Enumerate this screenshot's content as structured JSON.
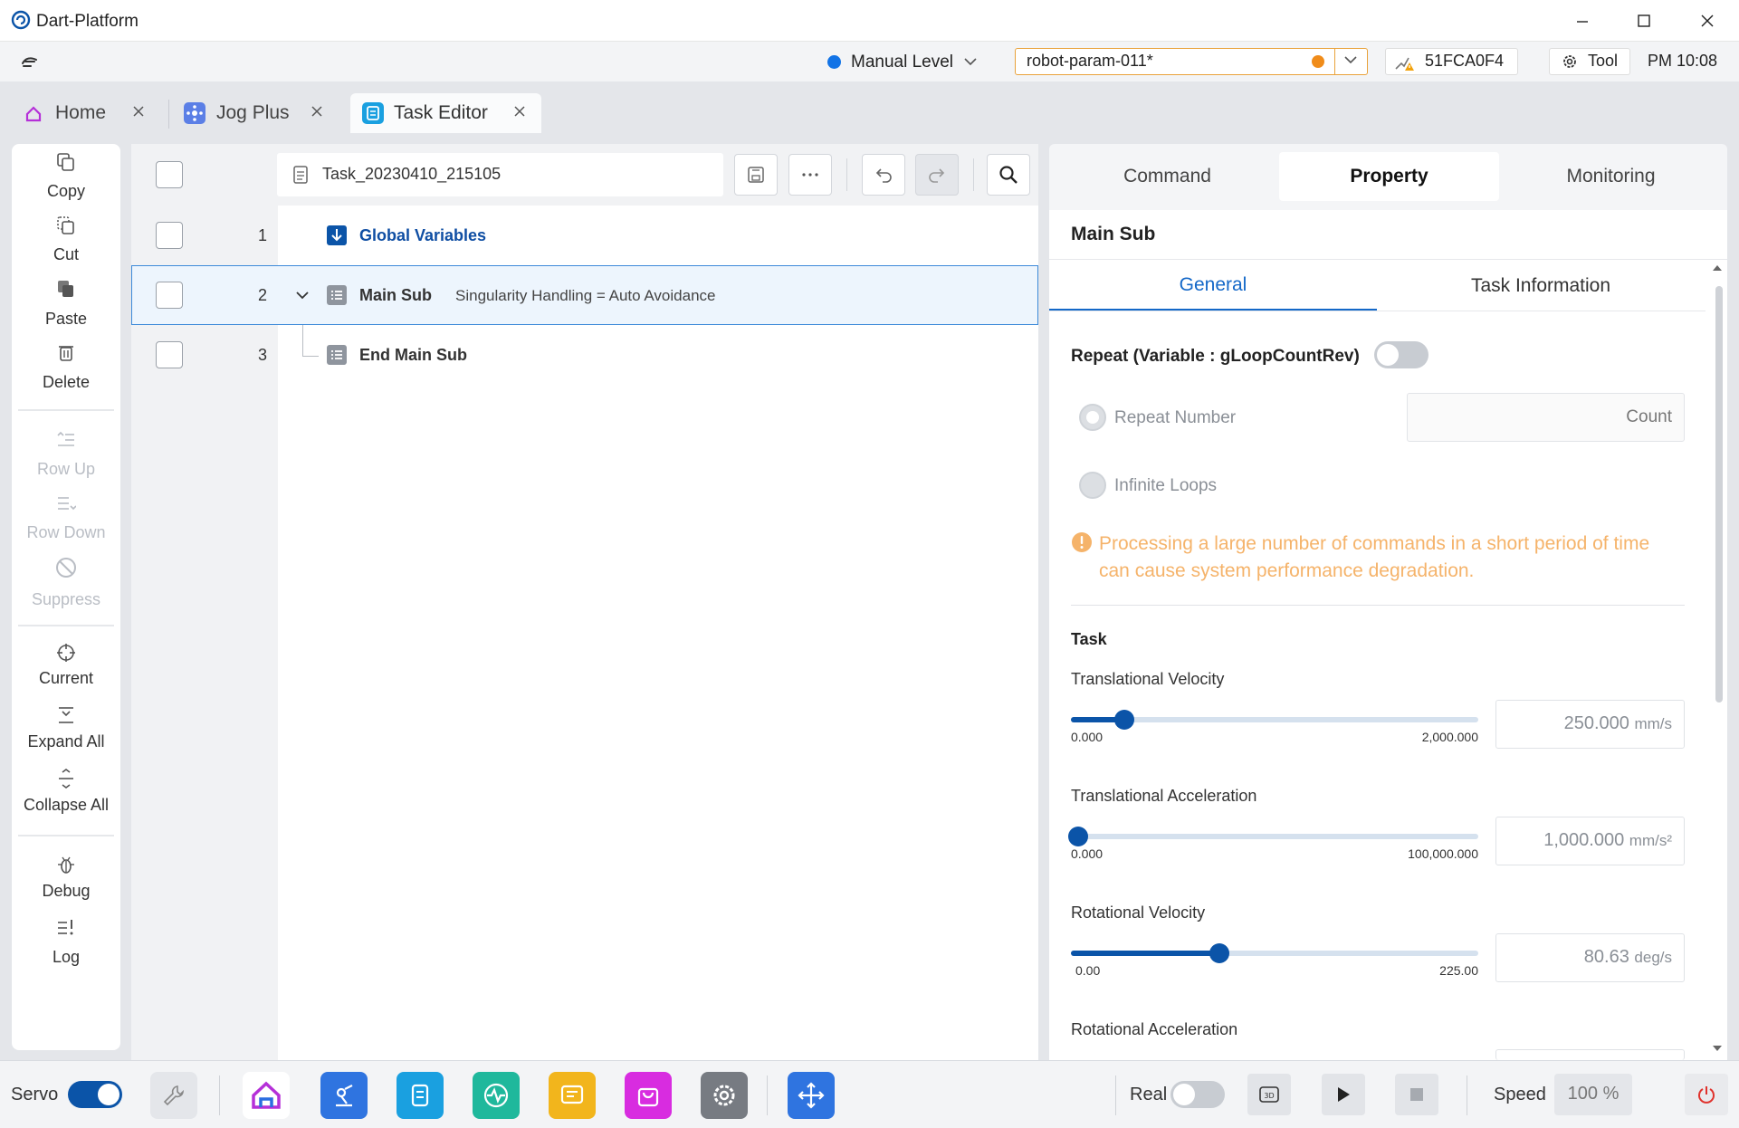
{
  "window": {
    "title": "Dart-Platform"
  },
  "statusbar": {
    "level": "Manual Level",
    "param": "robot-param-011*",
    "robot_id": "51FCA0F4",
    "tool": "Tool",
    "clock": "PM 10:08",
    "colors": {
      "level": "#1273e6",
      "param_border": "#e9a23b",
      "param_dot": "#f08c1a"
    }
  },
  "tabs": [
    {
      "label": "Home",
      "icon": "home-icon"
    },
    {
      "label": "Jog Plus",
      "icon": "jog-icon"
    },
    {
      "label": "Task Editor",
      "icon": "task-editor-icon",
      "active": true
    }
  ],
  "left_toolbar": {
    "copy": "Copy",
    "cut": "Cut",
    "paste": "Paste",
    "delete": "Delete",
    "row_up": "Row Up",
    "row_down": "Row Down",
    "suppress": "Suppress",
    "current": "Current",
    "expand_all": "Expand All",
    "collapse_all": "Collapse All",
    "debug": "Debug",
    "log": "Log"
  },
  "editor": {
    "task_name": "Task_20230410_215105",
    "rows": [
      {
        "num": "1",
        "label": "Global Variables"
      },
      {
        "num": "2",
        "label": "Main Sub",
        "detail": "Singularity Handling = Auto Avoidance"
      },
      {
        "num": "3",
        "label": "End Main Sub"
      }
    ]
  },
  "right": {
    "tabs": [
      "Command",
      "Property",
      "Monitoring"
    ],
    "title": "Main Sub",
    "subtabs": [
      "General",
      "Task Information"
    ],
    "repeat_label": "Repeat (Variable : gLoopCountRev)",
    "repeat_number": "Repeat Number",
    "count_placeholder": "Count",
    "infinite_loops": "Infinite Loops",
    "warning": "Processing a large number of commands in a short period of time can cause system performance degradation.",
    "task_section": "Task",
    "params": [
      {
        "label": "Translational Velocity",
        "min": "0.000",
        "max": "2,000.000",
        "value": "250.000",
        "unit": "mm/s",
        "fraction": 0.125
      },
      {
        "label": "Translational Acceleration",
        "min": "0.000",
        "max": "100,000.000",
        "value": "1,000.000",
        "unit": "mm/s²",
        "fraction": 0.01
      },
      {
        "label": "Rotational Velocity",
        "min": "0.00",
        "max": "225.00",
        "value": "80.63",
        "unit": "deg/s",
        "fraction": 0.358
      },
      {
        "label": "Rotational Acceleration"
      }
    ]
  },
  "dock": {
    "servo": "Servo",
    "real": "Real",
    "speed_label": "Speed",
    "speed": "100 %",
    "accent": "#0b54a8"
  }
}
